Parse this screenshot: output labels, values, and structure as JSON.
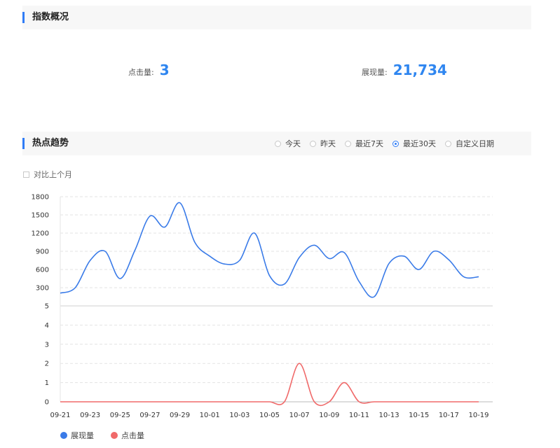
{
  "overview": {
    "title": "指数概况",
    "click_label": "点击量:",
    "click_value": "3",
    "show_label": "展现量:",
    "show_value": "21,734"
  },
  "trend": {
    "title": "热点趋势",
    "ranges": [
      {
        "label": "今天",
        "selected": false
      },
      {
        "label": "昨天",
        "selected": false
      },
      {
        "label": "最近7天",
        "selected": false
      },
      {
        "label": "最近30天",
        "selected": true
      },
      {
        "label": "自定义日期",
        "selected": false
      }
    ],
    "compare_label": "对比上个月"
  },
  "colors": {
    "accent": "#2f7cf6",
    "show": "#3a7be8",
    "click": "#f06a6a",
    "value": "#2f86f0"
  },
  "chart_data": {
    "type": "line",
    "x": [
      "09-21",
      "09-22",
      "09-23",
      "09-24",
      "09-25",
      "09-26",
      "09-27",
      "09-28",
      "09-29",
      "09-30",
      "10-01",
      "10-02",
      "10-03",
      "10-04",
      "10-05",
      "10-06",
      "10-07",
      "10-08",
      "10-09",
      "10-10",
      "10-11",
      "10-12",
      "10-13",
      "10-14",
      "10-15",
      "10-16",
      "10-17",
      "10-18",
      "10-19"
    ],
    "x_tick_labels": [
      "09-21",
      "09-23",
      "09-25",
      "09-27",
      "09-29",
      "10-01",
      "10-03",
      "10-05",
      "10-07",
      "10-09",
      "10-11",
      "10-13",
      "10-15",
      "10-17",
      "10-19"
    ],
    "panels": [
      {
        "series": "展现量",
        "ylim": [
          0,
          1800
        ],
        "yticks": [
          "300",
          "600",
          "900",
          "1200",
          "1500",
          "1800"
        ]
      },
      {
        "series": "点击量",
        "ylim": [
          0,
          5
        ],
        "yticks": [
          "0",
          "1",
          "2",
          "3",
          "4",
          "5"
        ]
      }
    ],
    "series": [
      {
        "name": "展现量",
        "color": "#3a7be8",
        "values": [
          210,
          300,
          750,
          900,
          450,
          920,
          1480,
          1300,
          1700,
          1050,
          820,
          690,
          750,
          1200,
          500,
          360,
          800,
          1000,
          780,
          880,
          400,
          150,
          700,
          820,
          600,
          900,
          760,
          480,
          480
        ]
      },
      {
        "name": "点击量",
        "color": "#f06a6a",
        "values": [
          0,
          0,
          0,
          0,
          0,
          0,
          0,
          0,
          0,
          0,
          0,
          0,
          0,
          0,
          0,
          0,
          2,
          0,
          0,
          1,
          0,
          0,
          0,
          0,
          0,
          0,
          0,
          0,
          0
        ]
      }
    ],
    "legend": [
      "展现量",
      "点击量"
    ],
    "legend_position": "bottom-left",
    "grid": true
  }
}
